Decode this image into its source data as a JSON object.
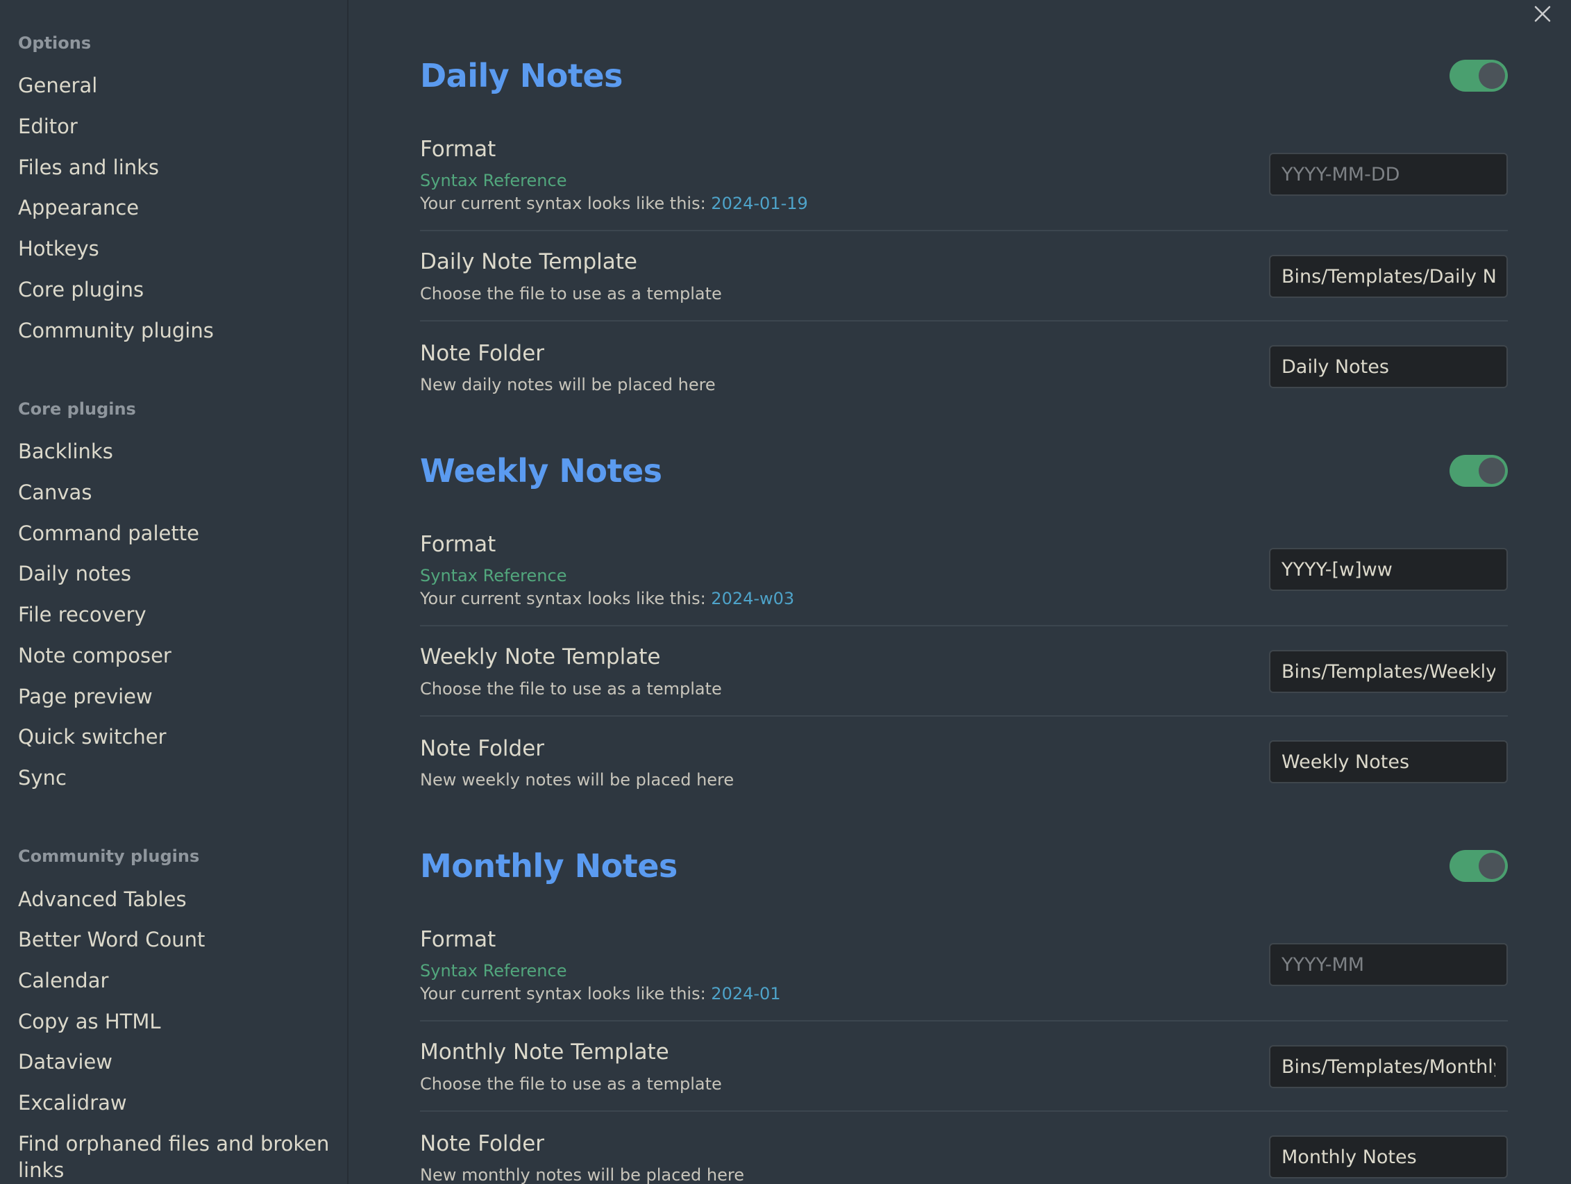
{
  "sidebar": {
    "options_heading": "Options",
    "options_items": [
      "General",
      "Editor",
      "Files and links",
      "Appearance",
      "Hotkeys",
      "Core plugins",
      "Community plugins"
    ],
    "core_heading": "Core plugins",
    "core_items": [
      "Backlinks",
      "Canvas",
      "Command palette",
      "Daily notes",
      "File recovery",
      "Note composer",
      "Page preview",
      "Quick switcher",
      "Sync"
    ],
    "community_heading": "Community plugins",
    "community_items": [
      "Advanced Tables",
      "Better Word Count",
      "Calendar",
      "Copy as HTML",
      "Dataview",
      "Excalidraw",
      "Find orphaned files and broken links"
    ]
  },
  "close_icon": "close-icon",
  "syntax_link_label": "Syntax Reference",
  "syntax_prefix": "Your current syntax looks like this: ",
  "template_desc": "Choose the file to use as a template",
  "sections": {
    "daily": {
      "title": "Daily Notes",
      "enabled": true,
      "format_label": "Format",
      "format_value": "",
      "format_placeholder": "YYYY-MM-DD",
      "format_preview": "2024-01-19",
      "template_label": "Daily Note Template",
      "template_value": "Bins/Templates/Daily Note",
      "folder_label": "Note Folder",
      "folder_desc": "New daily notes will be placed here",
      "folder_value": "Daily Notes"
    },
    "weekly": {
      "title": "Weekly Notes",
      "enabled": true,
      "format_label": "Format",
      "format_value": "YYYY-[w]ww",
      "format_placeholder": "",
      "format_preview": "2024-w03",
      "template_label": "Weekly Note Template",
      "template_value": "Bins/Templates/Weekly Review",
      "folder_label": "Note Folder",
      "folder_desc": "New weekly notes will be placed here",
      "folder_value": "Weekly Notes"
    },
    "monthly": {
      "title": "Monthly Notes",
      "enabled": true,
      "format_label": "Format",
      "format_value": "",
      "format_placeholder": "YYYY-MM",
      "format_preview": "2024-01",
      "template_label": "Monthly Note Template",
      "template_value": "Bins/Templates/Monthly Review",
      "folder_label": "Note Folder",
      "folder_desc": "New monthly notes will be placed here",
      "folder_value": "Monthly Notes"
    }
  },
  "colors": {
    "background": "#2e3740",
    "accent_heading": "#5b9bf0",
    "toggle_on": "#4a9f6f",
    "link": "#52a77d",
    "syntax_value": "#4ea3c9"
  }
}
